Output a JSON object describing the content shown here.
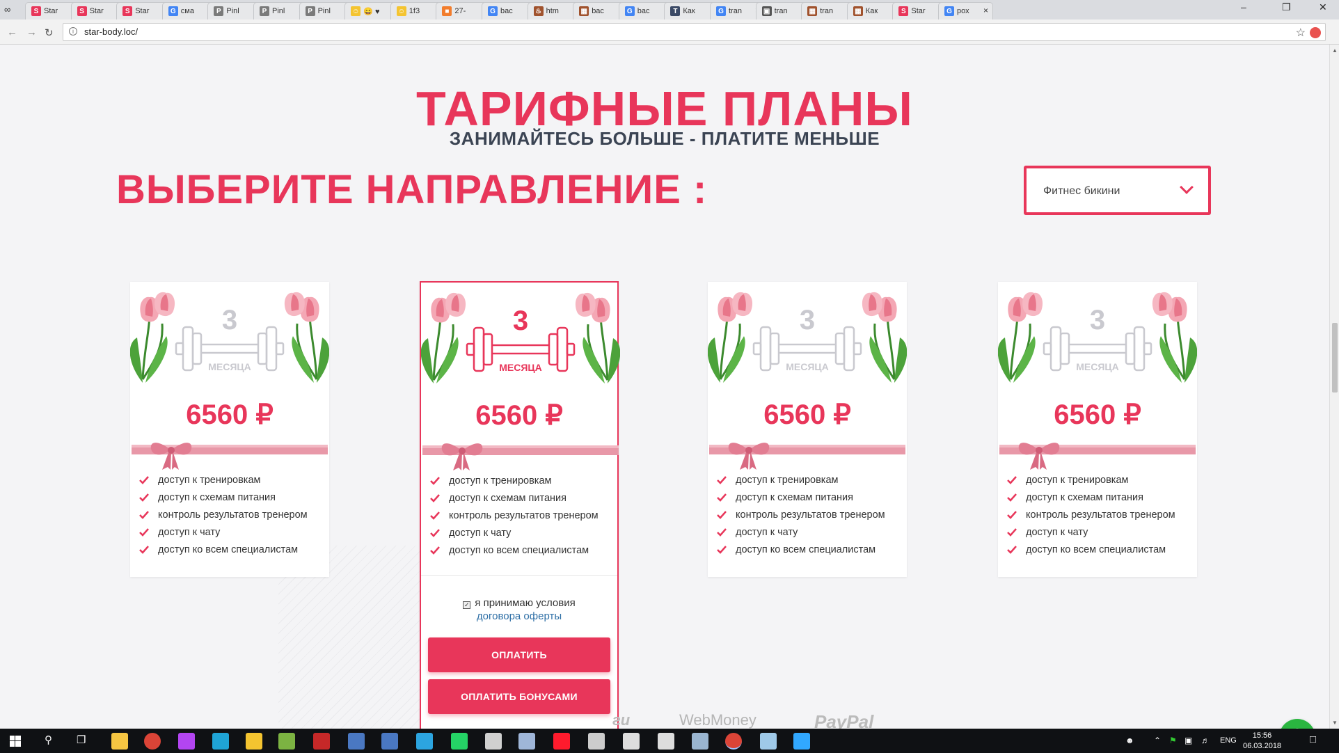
{
  "browser": {
    "url": "star-body.loc/",
    "tabs": [
      {
        "title": "Star",
        "fav": "S",
        "color": "#e8365a"
      },
      {
        "title": "Star",
        "fav": "S",
        "color": "#e8365a"
      },
      {
        "title": "Star",
        "fav": "S",
        "color": "#e8365a"
      },
      {
        "title": "сма",
        "fav": "G",
        "color": "#4285f4"
      },
      {
        "title": "Pinl",
        "fav": "P",
        "color": "#7a7a7a"
      },
      {
        "title": "Pinl",
        "fav": "P",
        "color": "#7a7a7a"
      },
      {
        "title": "Pinl",
        "fav": "P",
        "color": "#7a7a7a"
      },
      {
        "title": "😄 ♥",
        "fav": "☺",
        "color": "#f4c430"
      },
      {
        "title": "1f3",
        "fav": "☺",
        "color": "#f4c430"
      },
      {
        "title": "27-",
        "fav": "■",
        "color": "#f27d2d"
      },
      {
        "title": "bac",
        "fav": "G",
        "color": "#4285f4"
      },
      {
        "title": "htm",
        "fav": "♨",
        "color": "#a0522d"
      },
      {
        "title": "bac",
        "fav": "▦",
        "color": "#a0522d"
      },
      {
        "title": "bac",
        "fav": "G",
        "color": "#4285f4"
      },
      {
        "title": "Как",
        "fav": "T",
        "color": "#3b4a66"
      },
      {
        "title": "tran",
        "fav": "G",
        "color": "#4285f4"
      },
      {
        "title": "tran",
        "fav": "▣",
        "color": "#555"
      },
      {
        "title": "tran",
        "fav": "▦",
        "color": "#a0522d"
      },
      {
        "title": "Как",
        "fav": "▦",
        "color": "#a0522d"
      },
      {
        "title": "Star",
        "fav": "S",
        "color": "#e8365a"
      },
      {
        "title": "рох",
        "fav": "G",
        "color": "#4285f4"
      }
    ]
  },
  "page": {
    "title": "ТАРИФНЫЕ ПЛАНЫ",
    "subtitle": "ЗАНИМАЙТЕСЬ БОЛЬШЕ - ПЛАТИТЕ МЕНЬШЕ",
    "choose_label": "ВЫБЕРИТЕ НАПРАВЛЕНИЕ :",
    "direction_select": {
      "value": "Фитнес бикини"
    },
    "accent_color": "#e8365a",
    "plans": [
      {
        "period_number": "3",
        "period_label": "МЕСЯЦА",
        "price": "6560 ₽",
        "selected": false,
        "features": [
          "доступ к тренировкам",
          "доступ к схемам питания",
          "контроль результатов тренером",
          "доступ к чату",
          "доступ ко всем специалистам"
        ]
      },
      {
        "period_number": "3",
        "period_label": "МЕСЯЦА",
        "price": "6560 ₽",
        "selected": true,
        "features": [
          "доступ к тренировкам",
          "доступ к схемам питания",
          "контроль результатов тренером",
          "доступ к чату",
          "доступ ко всем специалистам"
        ],
        "terms_text": "я принимаю условия",
        "terms_link": "договора оферты",
        "terms_checked": true,
        "pay_button": "ОПЛАТИТЬ",
        "pay_bonus_button": "ОПЛАТИТЬ БОНУСАМИ"
      },
      {
        "period_number": "3",
        "period_label": "МЕСЯЦА",
        "price": "6560 ₽",
        "selected": false,
        "features": [
          "доступ к тренировкам",
          "доступ к схемам питания",
          "контроль результатов тренером",
          "доступ к чату",
          "доступ ко всем специалистам"
        ]
      },
      {
        "period_number": "3",
        "period_label": "МЕСЯЦА",
        "price": "6560 ₽",
        "selected": false,
        "features": [
          "доступ к тренировкам",
          "доступ к схемам питания",
          "контроль результатов тренером",
          "доступ к чату",
          "доступ ко всем специалистам"
        ]
      }
    ],
    "payment_logos": [
      "WebMoney",
      "PayPal"
    ]
  },
  "taskbar": {
    "time": "15:56",
    "date": "06.03.2018",
    "lang": "ENG",
    "apps": [
      {
        "name": "file-explorer",
        "color": "#f5c542"
      },
      {
        "name": "chrome",
        "color": "#db4437"
      },
      {
        "name": "phpstorm",
        "color": "#b345f1"
      },
      {
        "name": "webstorm",
        "color": "#1fa4d6"
      },
      {
        "name": "gulp",
        "color": "#f4c430"
      },
      {
        "name": "notepad",
        "color": "#7cb342"
      },
      {
        "name": "filezilla",
        "color": "#c62828"
      },
      {
        "name": "network",
        "color": "#4a78c2"
      },
      {
        "name": "editor",
        "color": "#4a78c2"
      },
      {
        "name": "telegram",
        "color": "#2ca5e0"
      },
      {
        "name": "whatsapp",
        "color": "#25d366"
      },
      {
        "name": "paint",
        "color": "#d0d0d0"
      },
      {
        "name": "monitor",
        "color": "#9fb6d8"
      },
      {
        "name": "opera",
        "color": "#ff1b2d"
      },
      {
        "name": "photos",
        "color": "#cccccc"
      },
      {
        "name": "calculator",
        "color": "#dddddd"
      },
      {
        "name": "settings",
        "color": "#dddddd"
      },
      {
        "name": "inkscape",
        "color": "#9ab5d0"
      },
      {
        "name": "chrome-active",
        "color": "#db4437"
      },
      {
        "name": "notes",
        "color": "#9fc9e8"
      },
      {
        "name": "photoshop",
        "color": "#31a8ff"
      }
    ]
  }
}
